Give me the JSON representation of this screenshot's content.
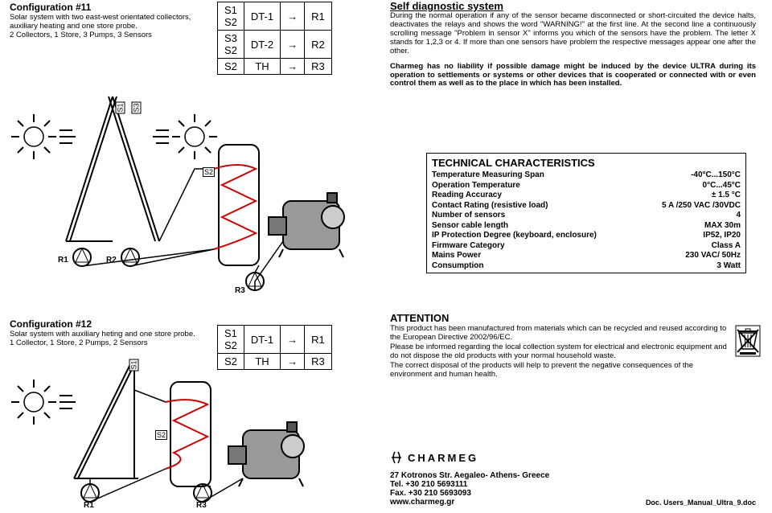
{
  "config11": {
    "title": "Configuration #11",
    "desc1": "Solar system with two east-west orientated collectors, auxiliary heating and one store probe.",
    "desc2": "2 Collectors, 1 Store, 3 Pumps, 3 Sensors"
  },
  "dt1": {
    "r1c1": "S1\nS2",
    "r1c2": "DT-1",
    "r1c3": "→",
    "r1c4": "R1",
    "r2c1": "S3\nS2",
    "r2c2": "DT-2",
    "r2c3": "→",
    "r2c4": "R2",
    "r3c1": "S2",
    "r3c2": "TH",
    "r3c3": "→",
    "r3c4": "R3"
  },
  "self_diag": {
    "title": "Self diagnostic system",
    "p1": "During the normal operation if any of the sensor became disconnected or short-circuited the device halts, deactivates the relays and shows the word \"WARNING!\" at the first line. At the second line a continuously scrolling message \"Problem in sensor X\" informs you which of the sensors have the problem. The letter X stands for 1,2,3 or 4. If more than one sensors have problem the respective messages appear one after the other.",
    "p2": "Charmeg has no liability if possible damage might be induced by the device ULTRA during its operation to settlements or systems or other devices that is cooperated or connected with or even control them as well as to the place in which has been installed."
  },
  "tech": {
    "title": "TECHNICAL CHARACTERISTICS",
    "rows": [
      {
        "k": "Temperature Measuring Span",
        "v": "-40°C...150°C"
      },
      {
        "k": "Operation Temperature",
        "v": "0°C...45°C"
      },
      {
        "k": "Reading Accuracy",
        "v": "± 1.5 °C"
      },
      {
        "k": "Contact Rating (resistive load)",
        "v": "5 A /250 VAC /30VDC"
      },
      {
        "k": "Number of sensors",
        "v": "4"
      },
      {
        "k": "Sensor cable length",
        "v": "MAX 30m"
      },
      {
        "k": "IP Protection Degree (keyboard, enclosure)",
        "v": "IP52, IP20"
      },
      {
        "k": "Firmware Category",
        "v": "Class A"
      },
      {
        "k": "Mains Power",
        "v": "230 VAC/ 50Hz"
      },
      {
        "k": "Consumption",
        "v": "3 Watt"
      }
    ]
  },
  "config12": {
    "title": "Configuration #12",
    "desc1": "Solar system with auxiliary heting and one store probe.",
    "desc2": "1 Collector, 1 Store, 2 Pumps, 2 Sensors"
  },
  "dt2": {
    "r1c1": "S1\nS2",
    "r1c2": "DT-1",
    "r1c3": "→",
    "r1c4": "R1",
    "r2c1": "S2",
    "r2c2": "TH",
    "r2c3": "→",
    "r2c4": "R3"
  },
  "attention": {
    "title": "ATTENTION",
    "p1": "This product has been manufactured from materials which can be recycled and reused according to the European Directive 2002/96/EC.",
    "p2": "Please be informed regarding the local collection system for electrical and electronic equipment and do not dispose the old products with your normal household waste.",
    "p3": "The correct disposal of the products will help to prevent the negative consequences of the environment and human health."
  },
  "footer": {
    "brand": "CHARMEG",
    "addr": "27 Kotronos Str. Aegaleo- Athens- Greece",
    "tel": "Tel. +30 210 5693111",
    "fax": "Fax. +30 210 5693093",
    "web": "www.charmeg.gr",
    "doc": "Doc. Users_Manual_Ultra_9.doc"
  },
  "labels": {
    "S1": "S1",
    "S2": "S2",
    "S3": "S3",
    "R1": "R1",
    "R2": "R2",
    "R3": "R3"
  }
}
